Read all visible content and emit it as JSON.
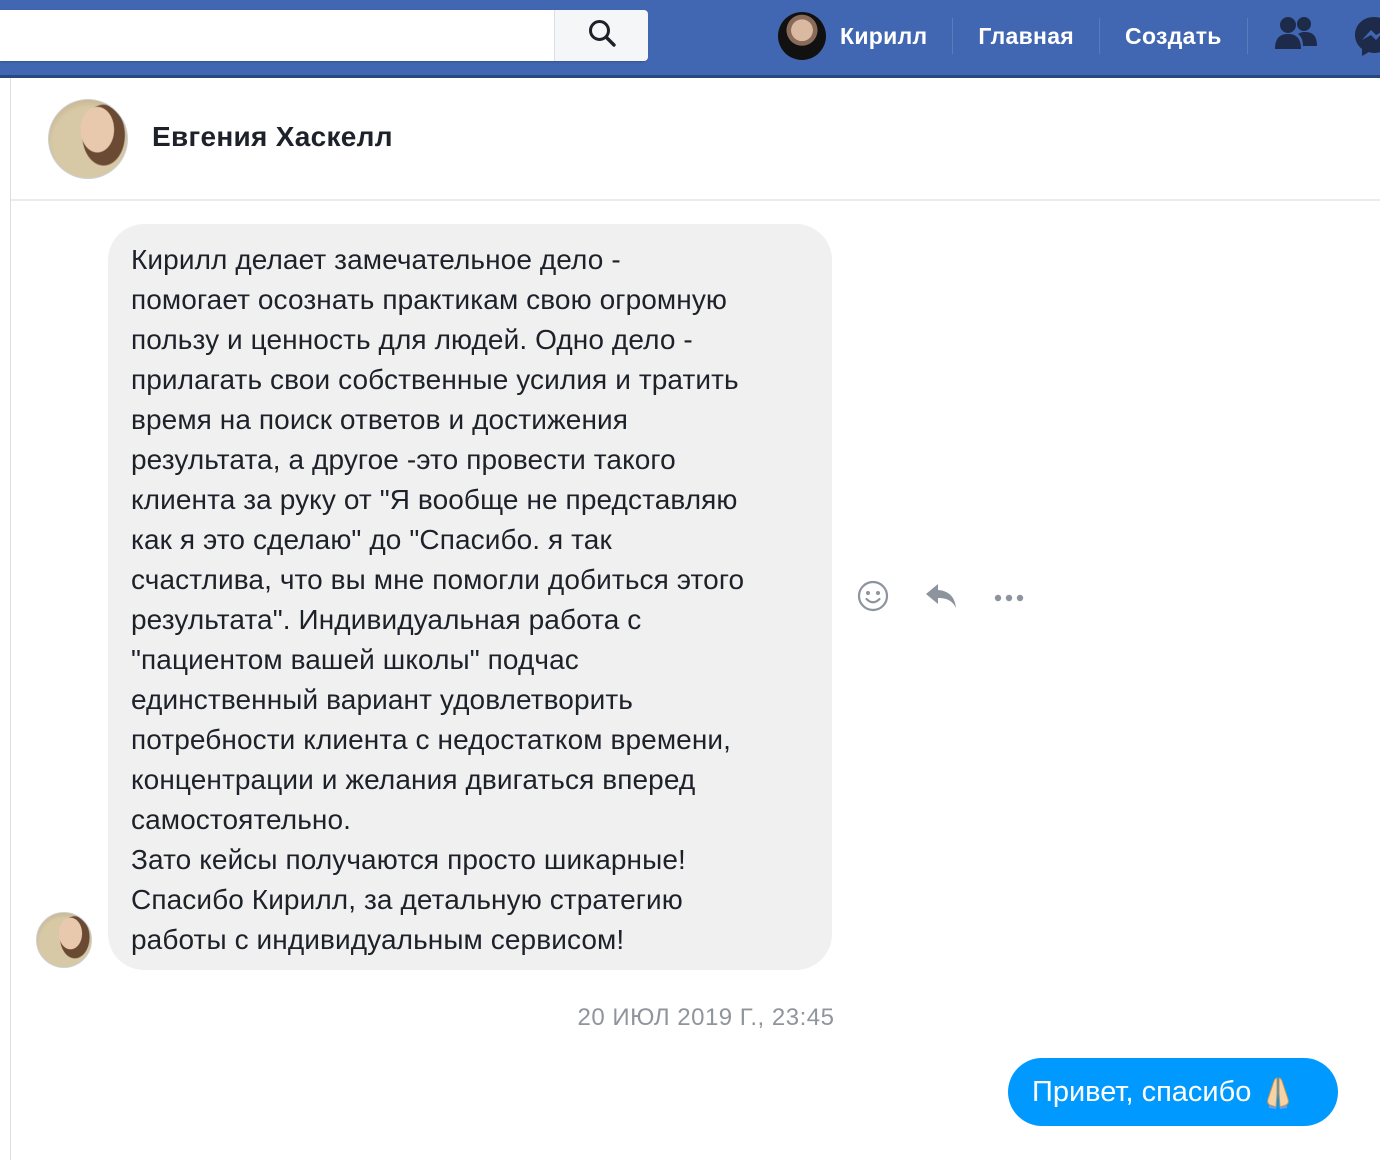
{
  "topbar": {
    "search": {
      "value": "",
      "placeholder": ""
    },
    "profile_name": "Кирилл",
    "nav_home": "Главная",
    "nav_create": "Создать"
  },
  "conversation": {
    "contact_name": "Евгения Хаскелл",
    "incoming_message_lines": [
      "Кирилл делает замечательное дело -",
      "помогает осознать практикам свою огромную",
      "пользу и ценность для людей. Одно дело -",
      "прилагать свои собственные усилия и тратить",
      "время на поиск ответов и достижения",
      "результата, а другое -это провести такого",
      "клиента за руку от \"Я вообще не представляю",
      "как я это сделаю\" до \"Спасибо. я так",
      "счастлива, что вы мне помогли добиться этого",
      "результата\". Индивидуальная работа с",
      "\"пациентом вашей школы\" подчас",
      "единственный вариант удовлетворить",
      "потребности клиента с недостатком времени,",
      "концентрации и желания двигаться вперед",
      "самостоятельно.",
      "Зато кейсы получаются просто шикарные!",
      "Спасибо Кирилл, за детальную стратегию",
      "работы с индивидуальным сервисом!"
    ],
    "timestamp": "20 ИЮЛ 2019 Г., 23:45",
    "outgoing_message": "Привет, спасибо",
    "outgoing_emoji": "folded-hands-emoji"
  },
  "colors": {
    "topbar": "#4267b2",
    "incoming_bubble": "#f1f0f0",
    "outgoing_bubble": "#0099ff",
    "timestamp": "#90949c",
    "action_icons": "#8d949e"
  }
}
